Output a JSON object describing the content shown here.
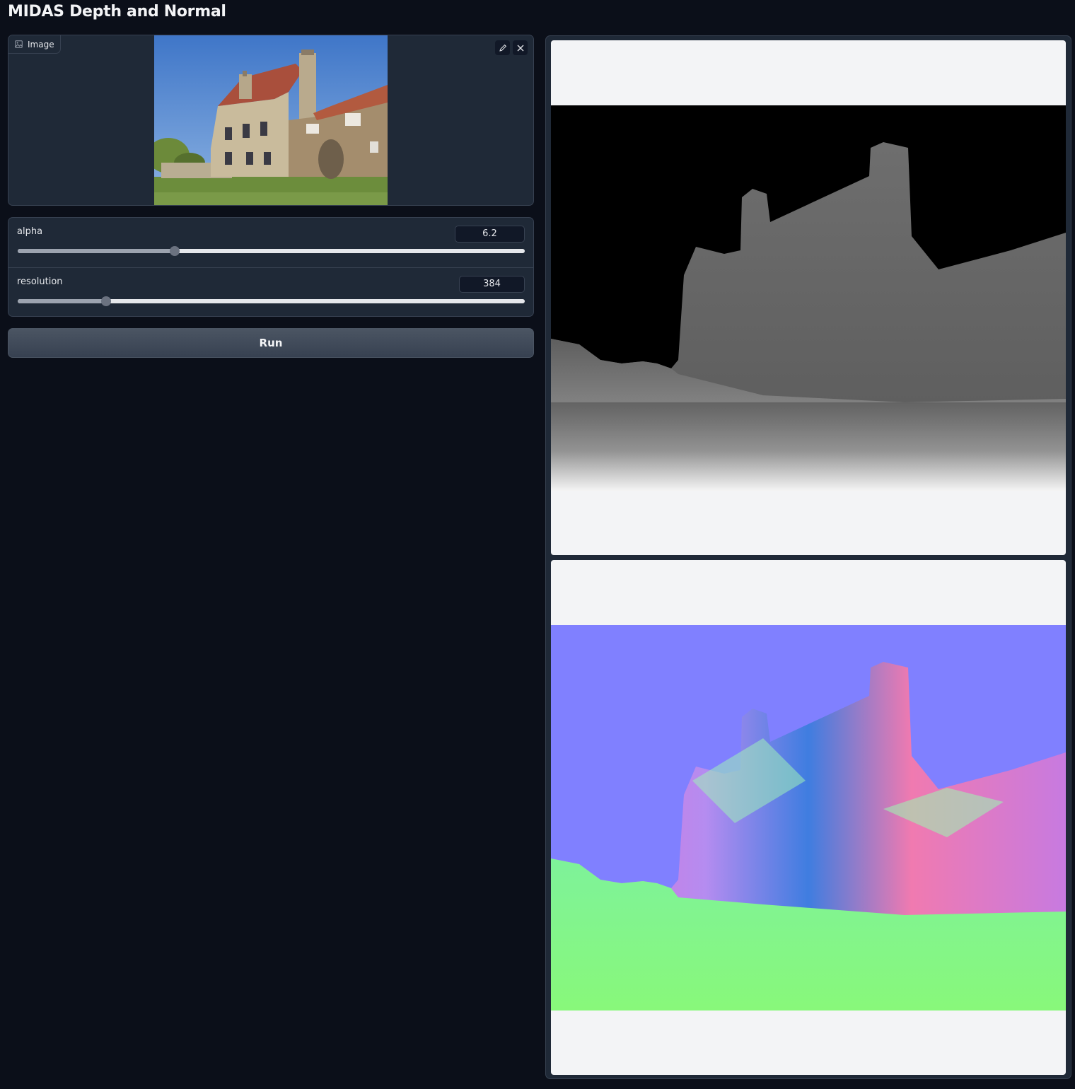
{
  "app": {
    "title": "MIDAS Depth and Normal"
  },
  "input_image": {
    "label": "Image",
    "label_icon": "image-icon",
    "edit_icon": "pencil-icon",
    "clear_icon": "close-icon"
  },
  "sliders": [
    {
      "label": "alpha",
      "value": "6.2",
      "fraction": 0.31
    },
    {
      "label": "resolution",
      "value": "384",
      "fraction": 0.174
    }
  ],
  "run_button": {
    "label": "Run"
  },
  "outputs": [
    {
      "kind": "depth-map"
    },
    {
      "kind": "normal-map"
    }
  ],
  "colors": {
    "background": "#0b0f19",
    "panel": "#1f2937",
    "border": "#374151",
    "output_bg": "#f3f4f6",
    "normal_sky": "#8080ff"
  }
}
